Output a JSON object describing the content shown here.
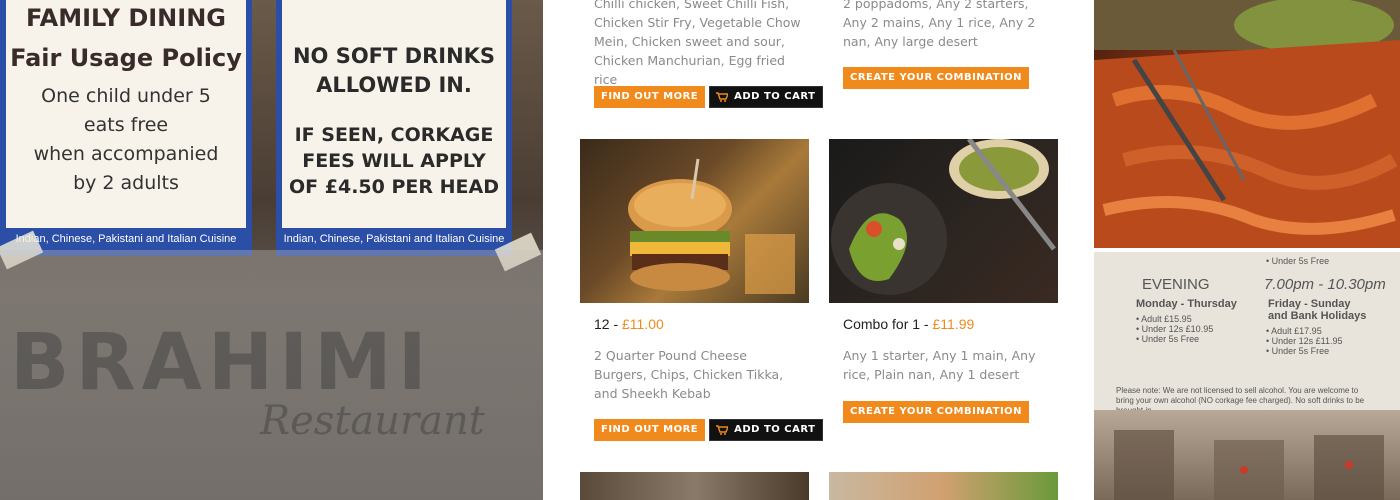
{
  "left_photo": {
    "sign_a": {
      "heading": "FAMILY DINING",
      "subheading": "Fair Usage Policy",
      "lines": [
        "One child under 5",
        "eats free",
        "when accompanied",
        "by 2 adults"
      ],
      "footer": "Indian, Chinese, Pakistani and Italian Cuisine"
    },
    "sign_b": {
      "line1": "NO SOFT DRINKS",
      "line2": "ALLOWED IN.",
      "line3": "IF SEEN, CORKAGE",
      "line4": "FEES WILL APPLY",
      "line5": "OF £4.50 PER HEAD",
      "footer": "Indian, Chinese, Pakistani and Italian Cuisine"
    },
    "brand": "BRAHIMI",
    "brand_sub": "Restaurant"
  },
  "cards": {
    "top_left": {
      "desc": "Chilli chicken, Sweet Chilli Fish, Chicken Stir Fry, Vegetable Chow Mein, Chicken sweet and sour, Chicken Manchurian, Egg fried rice",
      "find_out_more": "FIND OUT MORE",
      "add_to_cart": "ADD TO CART"
    },
    "top_right": {
      "desc": "2 poppadoms, Any 2 starters, Any 2 mains, Any 1 rice, Any 2 nan, Any large desert",
      "create_combination": "CREATE YOUR COMBINATION"
    },
    "mid_left": {
      "title": "12 - ",
      "price": "£11.00",
      "desc": "2 Quarter Pound Cheese Burgers, Chips, Chicken Tikka, and Sheekh Kebab",
      "find_out_more": "FIND OUT MORE",
      "add_to_cart": "ADD TO CART"
    },
    "mid_right": {
      "title": "Combo for 1 - ",
      "price": "£11.99",
      "desc": "Any 1 starter, Any 1 main, Any rice, Plain nan, Any 1 desert",
      "create_combination": "CREATE YOUR COMBINATION"
    }
  },
  "right_menu": {
    "top_lines": [
      "• Under 5s     Free"
    ],
    "evening": "EVENING",
    "time": "7.00pm - 10.30pm",
    "col_a_title": "Monday - Thursday",
    "col_a_rows": [
      "• Adult       £15.95",
      "• Under 12s  £10.95",
      "• Under 5s      Free"
    ],
    "col_b_title": "Friday - Sunday",
    "col_b_title2": "and Bank Holidays",
    "col_b_rows": [
      "• Adult       £17.95",
      "• Under 12s  £11.95",
      "• Under 5s      Free"
    ],
    "note": "Please note: We are not licensed to sell alcohol. You are welcome to bring your own alcohol (NO corkage fee charged). No soft drinks to be brought in."
  },
  "colors": {
    "accent": "#f08a1d",
    "sign_blue": "#2b4fa6"
  }
}
